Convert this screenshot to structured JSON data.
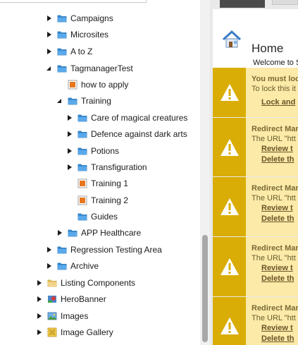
{
  "tree": {
    "items": [
      {
        "label": "Campaigns",
        "icon": "folder-icon",
        "state": "collapsed"
      },
      {
        "label": "Microsites",
        "icon": "folder-icon",
        "state": "collapsed"
      },
      {
        "label": "A to Z",
        "icon": "folder-icon",
        "state": "collapsed"
      },
      {
        "label": "TagmanagerTest",
        "icon": "folder-icon",
        "state": "expanded"
      },
      {
        "label": "how to apply",
        "icon": "page-icon",
        "state": "none"
      },
      {
        "label": "Training",
        "icon": "folder-icon",
        "state": "expanded"
      },
      {
        "label": "Care of magical creatures",
        "icon": "folder-icon",
        "state": "collapsed"
      },
      {
        "label": "Defence against dark arts",
        "icon": "folder-icon",
        "state": "collapsed"
      },
      {
        "label": "Potions",
        "icon": "folder-icon",
        "state": "collapsed"
      },
      {
        "label": "Transfiguration",
        "icon": "folder-icon",
        "state": "collapsed"
      },
      {
        "label": "Training 1",
        "icon": "page-icon",
        "state": "none"
      },
      {
        "label": "Training 2",
        "icon": "page-icon",
        "state": "none"
      },
      {
        "label": "Guides",
        "icon": "folder-icon",
        "state": "none"
      },
      {
        "label": "APP Healthcare",
        "icon": "folder-icon",
        "state": "collapsed"
      },
      {
        "label": "Regression Testing Area",
        "icon": "folder-icon",
        "state": "collapsed"
      },
      {
        "label": "Archive",
        "icon": "folder-icon",
        "state": "collapsed"
      },
      {
        "label": "Listing Components",
        "icon": "folder-plain-icon",
        "state": "collapsed"
      },
      {
        "label": "HeroBanner",
        "icon": "hero-banner-icon",
        "state": "collapsed"
      },
      {
        "label": "Images",
        "icon": "images-icon",
        "state": "collapsed"
      },
      {
        "label": "Image Gallery",
        "icon": "image-gallery-icon",
        "state": "collapsed"
      }
    ]
  },
  "home": {
    "title": "Home",
    "welcome": "Welcome to S"
  },
  "notices": [
    {
      "title": "You must loc",
      "text": "To lock this it",
      "links": [
        "Lock and"
      ]
    },
    {
      "title": "Redirect Mar",
      "text": "The URL \"htt",
      "links": [
        "Review t",
        "Delete th"
      ]
    },
    {
      "title": "Redirect Mar",
      "text": "The URL \"htt",
      "links": [
        "Review t",
        "Delete th"
      ]
    },
    {
      "title": "Redirect Mar",
      "text": "The URL \"htt",
      "links": [
        "Review t",
        "Delete th"
      ]
    },
    {
      "title": "Redirect Mar",
      "text": "The URL \"htt",
      "links": [
        "Review t",
        "Delete th"
      ]
    }
  ],
  "colors": {
    "warning_strip": "#d9ad05",
    "warning_bg": "#fbeaa8",
    "folder_blue": "#3a8fd6",
    "page_orange": "#e8761e"
  }
}
